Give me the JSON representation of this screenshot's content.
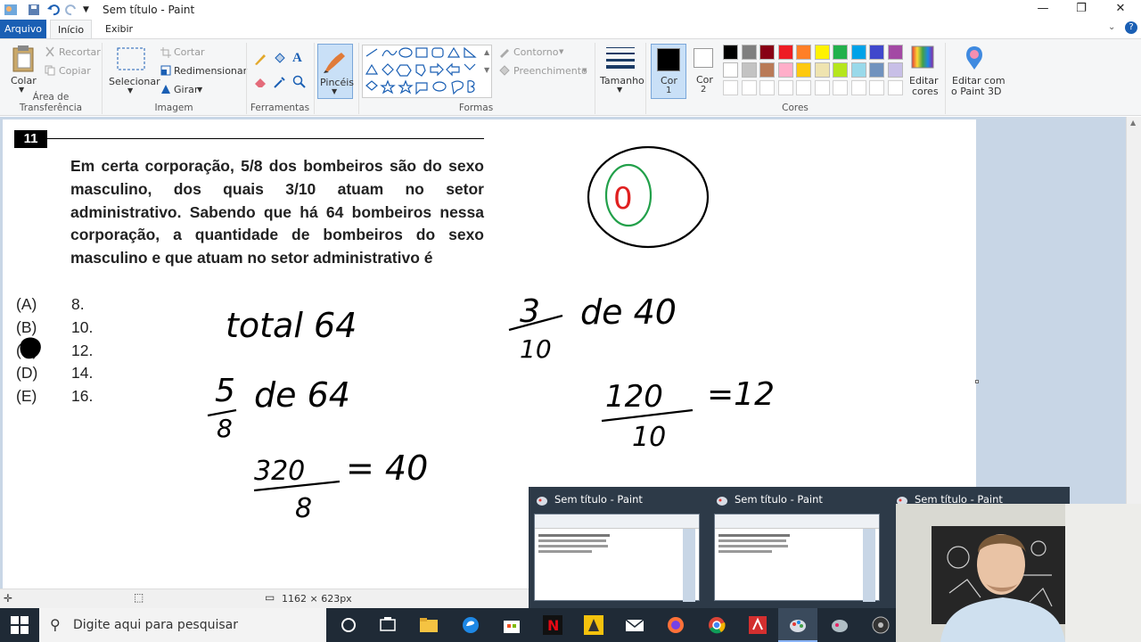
{
  "window": {
    "title": "Sem título - Paint",
    "minimize": "—",
    "maximize": "❐",
    "close": "✕"
  },
  "tabs": {
    "file": "Arquivo",
    "home": "Início",
    "view": "Exibir"
  },
  "ribbon": {
    "clipboard": {
      "paste": "Colar",
      "cut": "Recortar",
      "copy": "Copiar",
      "label": "Área de Transferência"
    },
    "image": {
      "select": "Selecionar",
      "crop": "Cortar",
      "resize": "Redimensionar",
      "rotate": "Girar",
      "label": "Imagem"
    },
    "tools": {
      "label": "Ferramentas"
    },
    "brushes": {
      "label": "Pincéis"
    },
    "shapes": {
      "outline": "Contorno",
      "fill": "Preenchimento",
      "label": "Formas"
    },
    "size": {
      "label": "Tamanho"
    },
    "colors": {
      "color1": "Cor\n1",
      "color1_a": "Cor",
      "color1_b": "1",
      "color2_a": "Cor",
      "color2_b": "2",
      "edit": "Editar",
      "edit_b": "cores",
      "paint3d": "Editar com",
      "paint3d_b": "o Paint 3D",
      "label": "Cores",
      "palette_row1": [
        "#000000",
        "#7f7f7f",
        "#880015",
        "#ed1c24",
        "#ff7f27",
        "#fff200",
        "#22b14c",
        "#00a2e8",
        "#3f48cc",
        "#a349a4"
      ],
      "palette_row2": [
        "#ffffff",
        "#c3c3c3",
        "#b97a57",
        "#ffaec9",
        "#ffc90e",
        "#efe4b0",
        "#b5e61d",
        "#99d9ea",
        "#7092be",
        "#c8bfe7"
      ]
    }
  },
  "question": {
    "number": "11",
    "text": "Em certa corporação, 5/8 dos bombeiros são do sexo masculino, dos quais 3/10 atuam no setor administrativo. Sabendo que há 64 bombeiros nessa corporação, a quantidade de bombeiros do sexo masculino e que atuam no setor administrativo é",
    "options": [
      {
        "letter": "(A)",
        "value": "8."
      },
      {
        "letter": "(B)",
        "value": "10."
      },
      {
        "letter": "(C)",
        "value": "12."
      },
      {
        "letter": "(D)",
        "value": "14."
      },
      {
        "letter": "(E)",
        "value": "16."
      }
    ]
  },
  "handwriting": {
    "total": "total 64",
    "frac1_num": "5",
    "frac1_den": "8",
    "frac1_rest": "de 64",
    "calc1_num": "320",
    "calc1_den": "8",
    "calc1_res": "= 40",
    "frac2_num": "3",
    "frac2_den": "10",
    "frac2_rest": "de 40",
    "calc2_num": "120",
    "calc2_den": "10",
    "calc2_res": "=12",
    "circle_mark": "0"
  },
  "statusbar": {
    "dimensions": "1162 × 623px"
  },
  "taskbar": {
    "search_placeholder": "Digite aqui para pesquisar"
  },
  "thumbnails": [
    {
      "title": "Sem título - Paint"
    },
    {
      "title": "Sem título - Paint"
    },
    {
      "title": "Sem título - Paint"
    }
  ]
}
